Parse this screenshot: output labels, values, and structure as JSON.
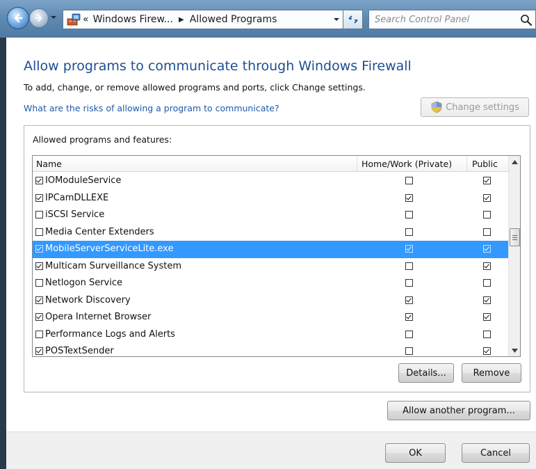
{
  "window": {
    "breadcrumb_prefix": "«",
    "breadcrumb_parent": "Windows Firew...",
    "breadcrumb_separator": "▶",
    "breadcrumb_current": "Allowed Programs",
    "search_placeholder": "Search Control Panel"
  },
  "page": {
    "title": "Allow programs to communicate through Windows Firewall",
    "subtitle": "To add, change, or remove allowed programs and ports, click Change settings.",
    "risk_link": "What are the risks of allowing a program to communicate?",
    "change_settings_label": "Change settings"
  },
  "list": {
    "group_label": "Allowed programs and features:",
    "columns": {
      "name": "Name",
      "private": "Home/Work (Private)",
      "public": "Public"
    },
    "rows": [
      {
        "name": "IOModuleService",
        "enabled": true,
        "private": false,
        "public": true,
        "selected": false
      },
      {
        "name": "IPCamDLLEXE",
        "enabled": true,
        "private": true,
        "public": true,
        "selected": false
      },
      {
        "name": "iSCSI Service",
        "enabled": false,
        "private": false,
        "public": false,
        "selected": false
      },
      {
        "name": "Media Center Extenders",
        "enabled": false,
        "private": false,
        "public": false,
        "selected": false
      },
      {
        "name": "MobileServerServiceLite.exe",
        "enabled": true,
        "private": true,
        "public": true,
        "selected": true
      },
      {
        "name": "Multicam Surveillance System",
        "enabled": true,
        "private": false,
        "public": true,
        "selected": false
      },
      {
        "name": "Netlogon Service",
        "enabled": false,
        "private": false,
        "public": false,
        "selected": false
      },
      {
        "name": "Network Discovery",
        "enabled": true,
        "private": true,
        "public": true,
        "selected": false
      },
      {
        "name": "Opera Internet Browser",
        "enabled": true,
        "private": true,
        "public": true,
        "selected": false
      },
      {
        "name": "Performance Logs and Alerts",
        "enabled": false,
        "private": false,
        "public": false,
        "selected": false
      },
      {
        "name": "POSTextSender",
        "enabled": true,
        "private": false,
        "public": true,
        "selected": false
      }
    ],
    "details_label": "Details...",
    "remove_label": "Remove"
  },
  "actions": {
    "allow_another_label": "Allow another program...",
    "ok_label": "OK",
    "cancel_label": "Cancel"
  },
  "colors": {
    "title_blue": "#1e4e90",
    "link_blue": "#1e5aa8",
    "selection": "#3399ff"
  }
}
